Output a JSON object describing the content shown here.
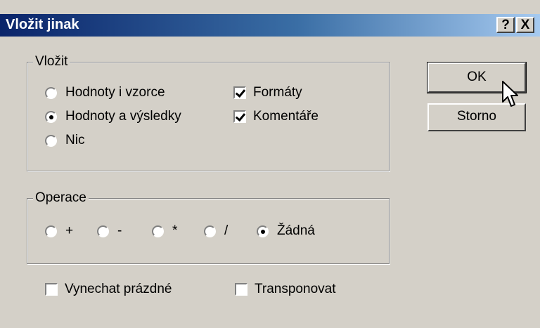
{
  "window": {
    "title": "Vložit jinak",
    "help_label": "?",
    "close_label": "X"
  },
  "paste_group": {
    "legend": "Vložit",
    "options": [
      {
        "label": "Hodnoty i vzorce",
        "selected": false
      },
      {
        "label": "Hodnoty a výsledky",
        "selected": true
      },
      {
        "label": "Nic",
        "selected": false
      }
    ],
    "checks": [
      {
        "label": "Formáty",
        "checked": true
      },
      {
        "label": "Komentáře",
        "checked": true
      }
    ]
  },
  "operation_group": {
    "legend": "Operace",
    "options": [
      {
        "label": "+",
        "selected": false
      },
      {
        "label": "-",
        "selected": false
      },
      {
        "label": "*",
        "selected": false
      },
      {
        "label": "/",
        "selected": false
      },
      {
        "label": "Žádná",
        "selected": true
      }
    ]
  },
  "bottom_checks": [
    {
      "label": "Vynechat prázdné",
      "checked": false
    },
    {
      "label": "Transponovat",
      "checked": false
    }
  ],
  "buttons": {
    "ok": "OK",
    "cancel": "Storno"
  },
  "icons": {
    "cursor": "mouse-pointer-icon"
  }
}
